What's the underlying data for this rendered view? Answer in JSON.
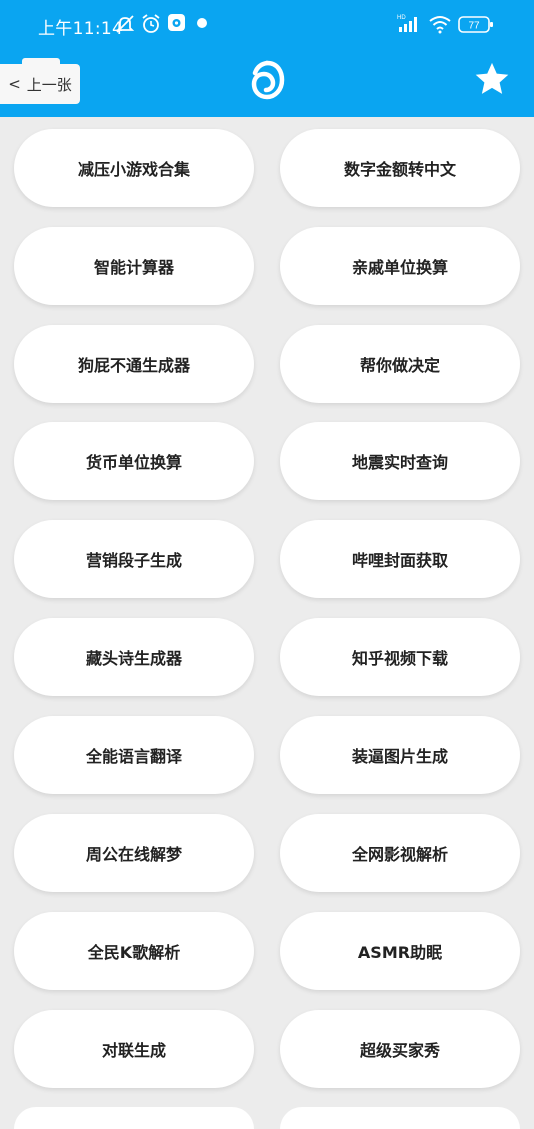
{
  "status_bar": {
    "time": "上午11:14",
    "battery": "77"
  },
  "header": {
    "back_label": "上一张",
    "back_chevron": "<",
    "logo_icon": "sound-wave-logo-icon",
    "favorite_icon": "star-icon",
    "accent_color": "#0aa5f1"
  },
  "tools": [
    {
      "label": "减压小游戏合集"
    },
    {
      "label": "数字金额转中文"
    },
    {
      "label": "智能计算器"
    },
    {
      "label": "亲戚单位换算"
    },
    {
      "label": "狗屁不通生成器"
    },
    {
      "label": "帮你做决定"
    },
    {
      "label": "货币单位换算"
    },
    {
      "label": "地震实时查询"
    },
    {
      "label": "营销段子生成"
    },
    {
      "label": "哔哩封面获取"
    },
    {
      "label": "藏头诗生成器"
    },
    {
      "label": "知乎视频下载"
    },
    {
      "label": "全能语言翻译"
    },
    {
      "label": "装逼图片生成"
    },
    {
      "label": "周公在线解梦"
    },
    {
      "label": "全网影视解析"
    },
    {
      "label": "全民K歌解析"
    },
    {
      "label": "ASMR助眠"
    },
    {
      "label": "对联生成"
    },
    {
      "label": "超级买家秀"
    },
    {
      "label": ""
    },
    {
      "label": ""
    }
  ]
}
